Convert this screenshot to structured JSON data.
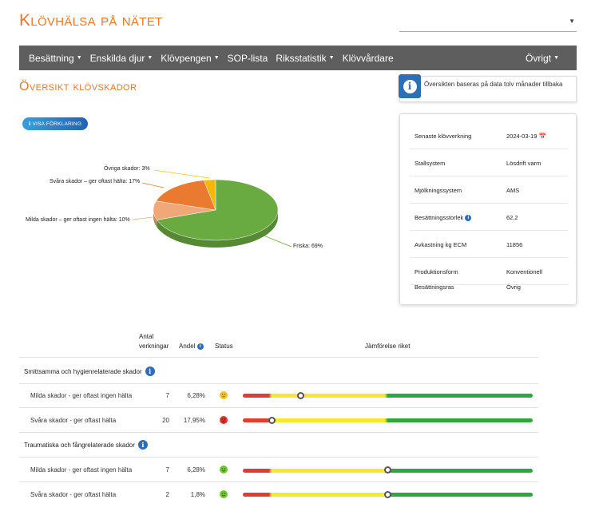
{
  "app": {
    "title": "Klövhälsa på nätet"
  },
  "nav": {
    "items": [
      {
        "label": "Besättning",
        "dropdown": true
      },
      {
        "label": "Enskilda djur",
        "dropdown": true
      },
      {
        "label": "Klövpengen",
        "dropdown": true
      },
      {
        "label": "SOP-lista",
        "dropdown": false
      },
      {
        "label": "Riksstatistik",
        "dropdown": true
      },
      {
        "label": "Klövvårdare",
        "dropdown": false
      }
    ],
    "right": {
      "label": "Övrigt",
      "dropdown": true
    }
  },
  "page": {
    "title": "Översikt klövskador"
  },
  "info": {
    "text": "Översikten baseras på data tolv månader tillbaka"
  },
  "explain_button": {
    "label": "Visa förklaring"
  },
  "chart_data": {
    "type": "pie",
    "slices": [
      {
        "label": "Friska: 69%",
        "value": 69,
        "color": "#6aab41"
      },
      {
        "label": "Milda skador – ger oftast ingen hälta: 10%",
        "value": 10,
        "color": "#f1a879"
      },
      {
        "label": "Svåra skador – ger oftast hälta: 17%",
        "value": 17,
        "color": "#ea7a2f"
      },
      {
        "label": "Övriga skador: 3%",
        "value": 3,
        "color": "#f5b70b"
      }
    ]
  },
  "farm": {
    "rows": [
      {
        "label": "Senaste klövverkning",
        "value": "2024-03-19",
        "icon": "calendar-icon"
      },
      {
        "label": "Stallsystem",
        "value": "Lösdrift varm"
      },
      {
        "label": "Mjölkningssystem",
        "value": "AMS"
      },
      {
        "label": "Besättningsstorlek",
        "value": "62,2",
        "icon": "info-icon"
      },
      {
        "label": "Avkastning kg ECM",
        "value": "11856"
      },
      {
        "label": "Produktionsform",
        "value": "Konventionell"
      },
      {
        "label": "Besättningsras",
        "value": "Övrig"
      }
    ]
  },
  "table": {
    "headers": {
      "count_line1": "Antal",
      "count_line2": "verkningar",
      "share": "Andel",
      "status": "Status",
      "compare": "Jämförelse riket"
    },
    "groups": [
      {
        "title": "Smittsamma och hygienrelaterade skador",
        "rows": [
          {
            "name": "Milda skador - ger oftast ingen hälta",
            "count": "7",
            "share": "6,28%",
            "status": "neutral",
            "status_color": "#f0c419",
            "comparison": 0.2
          },
          {
            "name": "Svåra skador - ger oftast hälta",
            "count": "20",
            "share": "17,95%",
            "status": "sad",
            "status_color": "#e0342c",
            "comparison": 0.1
          }
        ]
      },
      {
        "title": "Traumatiska och fångrelaterade skador",
        "rows": [
          {
            "name": "Milda skador - ger oftast ingen hälta",
            "count": "7",
            "share": "6,28%",
            "status": "happy",
            "status_color": "#6ec62f",
            "comparison": 0.5
          },
          {
            "name": "Svåra skador - ger oftast hälta",
            "count": "2",
            "share": "1,8%",
            "status": "happy",
            "status_color": "#6ec62f",
            "comparison": 0.5
          }
        ]
      }
    ]
  }
}
